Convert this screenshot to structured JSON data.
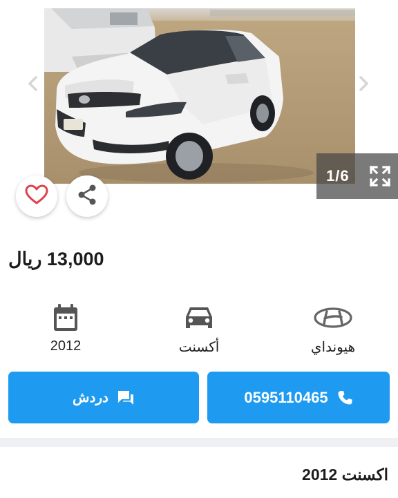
{
  "gallery": {
    "counter": "1/6",
    "prev_icon": "chevron-left-icon",
    "next_icon": "chevron-right-icon",
    "expand_icon": "expand-icon"
  },
  "actions": {
    "favorite_icon": "heart-icon",
    "share_icon": "share-icon"
  },
  "listing": {
    "price": "13,000 ريال",
    "title": "اكسنت 2012"
  },
  "specs": {
    "year": "2012",
    "model": "أكسنت",
    "brand": "هيونداي"
  },
  "buttons": {
    "chat_label": "دردش",
    "phone_label": "0595110465"
  },
  "colors": {
    "accent": "#1e9bf0",
    "heart": "#e0424b",
    "icon_gray": "#555555"
  }
}
